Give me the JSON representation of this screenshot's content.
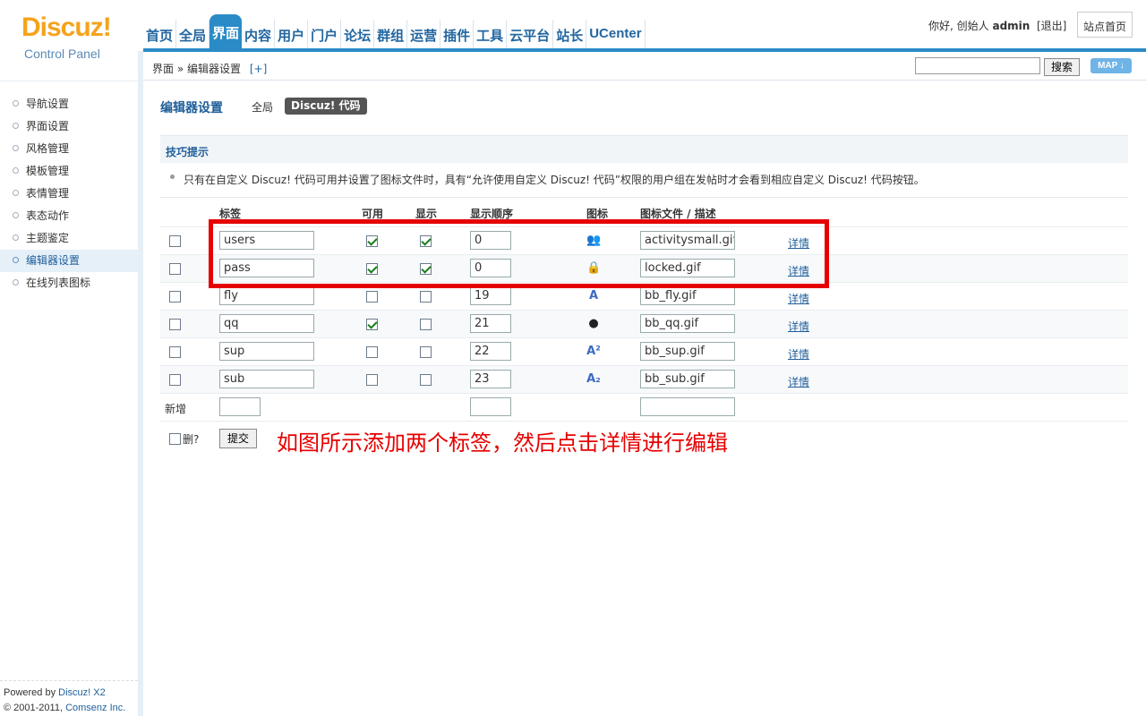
{
  "logo": {
    "main": "Discuz!",
    "sub": "Control Panel"
  },
  "nav": [
    "首页",
    "全局",
    "界面",
    "内容",
    "用户",
    "门户",
    "论坛",
    "群组",
    "运营",
    "插件",
    "工具",
    "云平台",
    "站长",
    "UCenter"
  ],
  "nav_active": "界面",
  "user": {
    "greeting": "你好, 创始人",
    "name": "admin",
    "logout": "[退出]",
    "site_home": "站点首页"
  },
  "breadcrumb": {
    "section": "界面",
    "sep": "»",
    "page": "编辑器设置",
    "add": "[+]"
  },
  "search": {
    "value": "",
    "button": "搜索",
    "map": "MAP ↓"
  },
  "sidebar": [
    "导航设置",
    "界面设置",
    "风格管理",
    "模板管理",
    "表情管理",
    "表态动作",
    "主题鉴定",
    "编辑器设置",
    "在线列表图标"
  ],
  "sidebar_active": "编辑器设置",
  "footer": {
    "powered_prefix": "Powered by ",
    "powered_link": "Discuz! X2",
    "copy_prefix": "© 2001-2011, ",
    "copy_link": "Comsenz Inc."
  },
  "page": {
    "title": "编辑器设置",
    "tab_global": "全局",
    "tab_active": "Discuz! 代码"
  },
  "tips": {
    "title": "技巧提示",
    "text": "只有在自定义 Discuz! 代码可用并设置了图标文件时，具有“允许使用自定义 Discuz! 代码”权限的用户组在发帖时才会看到相应自定义 Discuz! 代码按钮。"
  },
  "table": {
    "headers": [
      "标签",
      "可用",
      "显示",
      "显示顺序",
      "图标",
      "图标文件 / 描述"
    ],
    "rows": [
      {
        "tag": "users",
        "enabled": true,
        "shown": true,
        "order": "0",
        "icon": "users-icon",
        "file": "activitysmall.gif",
        "detail": "详情"
      },
      {
        "tag": "pass",
        "enabled": true,
        "shown": true,
        "order": "0",
        "icon": "lock-icon",
        "file": "locked.gif",
        "detail": "详情"
      },
      {
        "tag": "fly",
        "enabled": false,
        "shown": false,
        "order": "19",
        "icon": "fly-icon",
        "file": "bb_fly.gif",
        "detail": "详情"
      },
      {
        "tag": "qq",
        "enabled": true,
        "shown": false,
        "order": "21",
        "icon": "qq-icon",
        "file": "bb_qq.gif",
        "detail": "详情"
      },
      {
        "tag": "sup",
        "enabled": false,
        "shown": false,
        "order": "22",
        "icon": "sup-icon",
        "file": "bb_sup.gif",
        "detail": "详情"
      },
      {
        "tag": "sub",
        "enabled": false,
        "shown": false,
        "order": "23",
        "icon": "sub-icon",
        "file": "bb_sub.gif",
        "detail": "详情"
      }
    ],
    "new_label": "新增",
    "delete_label": "删?",
    "submit": "提交"
  },
  "annotation": "如图所示添加两个标签，然后点击详情进行编辑",
  "colors": {
    "accent": "#2b8bc7",
    "link": "#1f5e99",
    "logo": "#f4a31c",
    "highlight": "#e60000"
  }
}
